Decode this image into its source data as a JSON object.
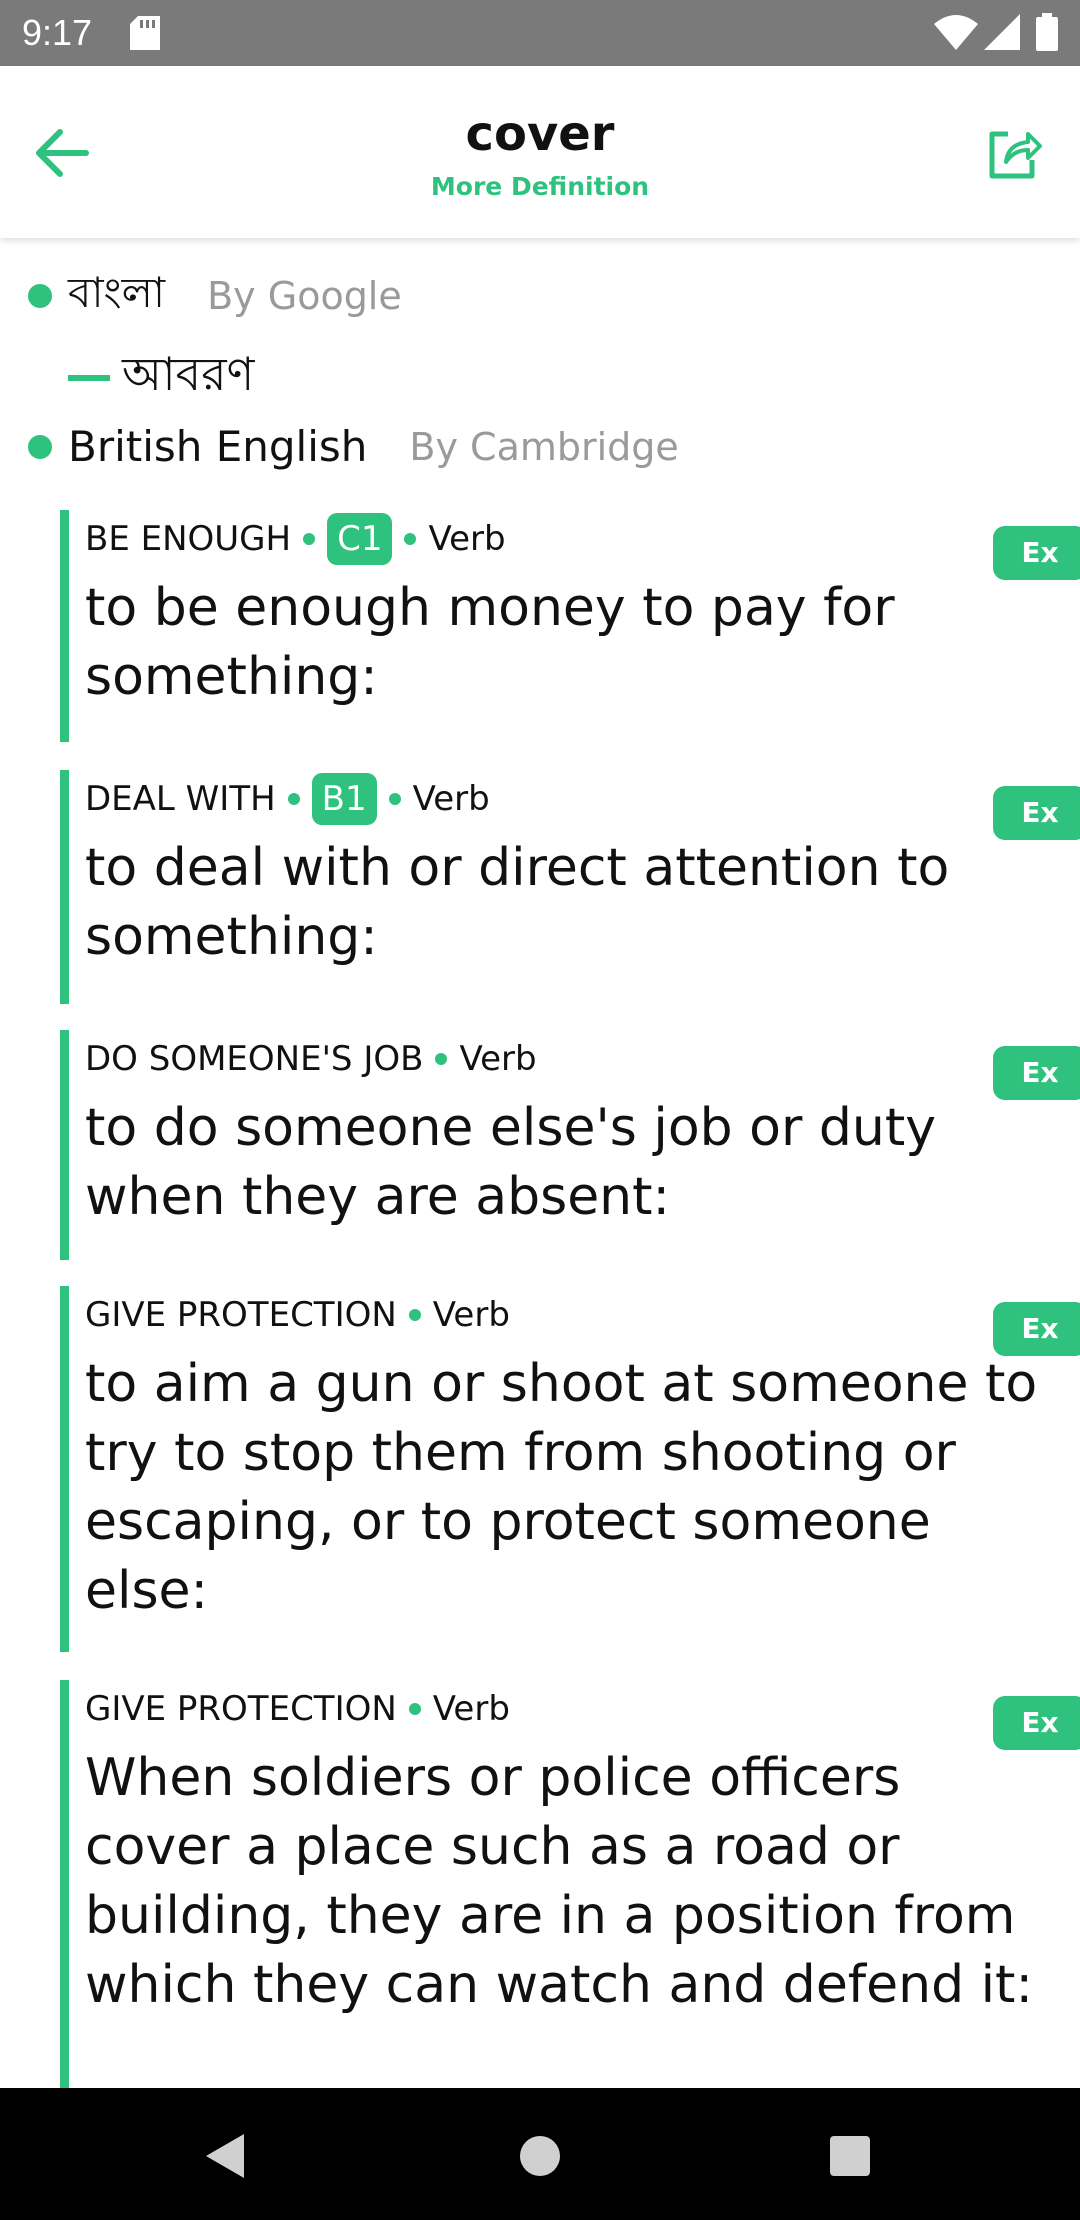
{
  "status_bar": {
    "time": "9:17"
  },
  "app_bar": {
    "title": "cover",
    "subtitle": "More Definition",
    "back_icon": "arrow-left-icon",
    "share_icon": "share-icon"
  },
  "accent_color": "#2ec27e",
  "languages": {
    "bangla": {
      "name": "বাংলা",
      "source": "By Google",
      "translation": "আবরণ"
    },
    "british": {
      "name": "British English",
      "source": "By Cambridge"
    }
  },
  "entries": [
    {
      "guide": "BE ENOUGH",
      "level": "C1",
      "pos": "Verb",
      "definition": "to be enough money to pay for something:",
      "ex_label": "Ex"
    },
    {
      "guide": "DEAL WITH",
      "level": "B1",
      "pos": "Verb",
      "definition": "to deal with or direct attention to something:",
      "ex_label": "Ex"
    },
    {
      "guide": "DO SOMEONE'S JOB",
      "pos": "Verb",
      "definition": "to do someone else's job or duty when they are absent:",
      "ex_label": "Ex"
    },
    {
      "guide": "GIVE PROTECTION",
      "pos": "Verb",
      "definition": "to aim a gun or shoot at someone to try to stop them from shooting or escaping, or to protect someone else:",
      "ex_label": "Ex"
    },
    {
      "guide": "GIVE PROTECTION",
      "pos": "Verb",
      "definition": "When soldiers or police officers cover a place such as a road or building, they are in a position from which they can watch and defend it:",
      "ex_label": "Ex"
    }
  ]
}
